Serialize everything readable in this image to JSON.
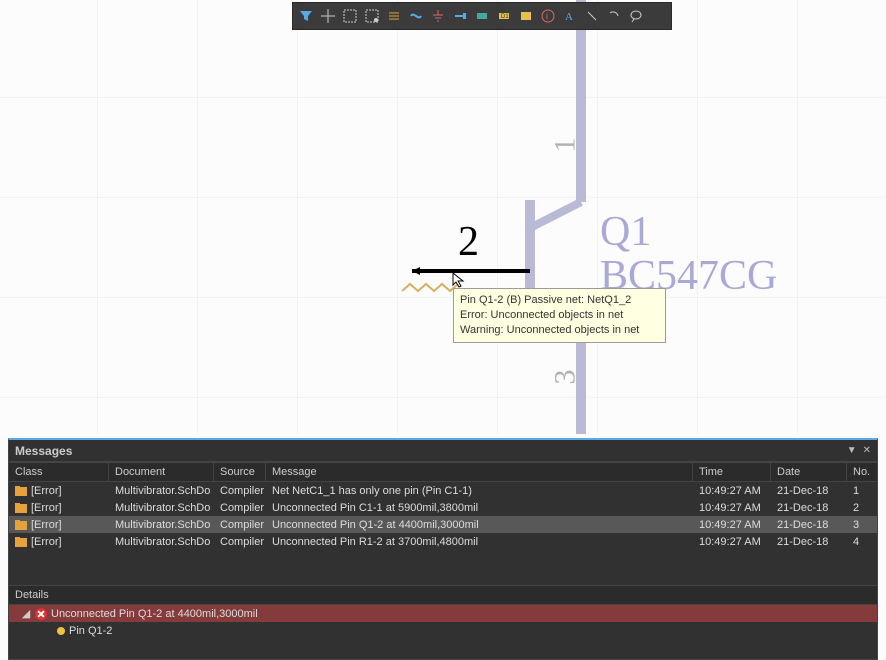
{
  "toolbar_icons": [
    "filter-icon",
    "crosshair-icon",
    "select-rect-icon",
    "select-lasso-icon",
    "connector-icon",
    "bus-icon",
    "ground-icon",
    "terminal-icon",
    "part-icon",
    "diode-icon",
    "text-label-icon",
    "info-icon",
    "annotate-icon",
    "undo-icon",
    "redo-icon",
    "lasso-icon"
  ],
  "schematic": {
    "pins": {
      "p1": "1",
      "p2": "2",
      "p3": "3"
    },
    "ref": "Q1",
    "part": "BC547CG"
  },
  "tooltip": {
    "line1": "Pin Q1-2 (B) Passive    net: NetQ1_2",
    "line2": "Error: Unconnected objects in net",
    "line3": "Warning: Unconnected objects in net"
  },
  "messages_panel": {
    "title": "Messages",
    "columns": {
      "class": "Class",
      "document": "Document",
      "source": "Source",
      "message": "Message",
      "time": "Time",
      "date": "Date",
      "no": "No."
    },
    "rows": [
      {
        "class": "[Error]",
        "document": "Multivibrator.SchDo",
        "source": "Compiler",
        "message": "Net NetC1_1 has only one pin (Pin C1-1)",
        "time": "10:49:27 AM",
        "date": "21-Dec-18",
        "no": "1",
        "selected": false
      },
      {
        "class": "[Error]",
        "document": "Multivibrator.SchDo",
        "source": "Compiler",
        "message": "Unconnected Pin C1-1 at 5900mil,3800mil",
        "time": "10:49:27 AM",
        "date": "21-Dec-18",
        "no": "2",
        "selected": false
      },
      {
        "class": "[Error]",
        "document": "Multivibrator.SchDo",
        "source": "Compiler",
        "message": "Unconnected Pin Q1-2 at 4400mil,3000mil",
        "time": "10:49:27 AM",
        "date": "21-Dec-18",
        "no": "3",
        "selected": true
      },
      {
        "class": "[Error]",
        "document": "Multivibrator.SchDo",
        "source": "Compiler",
        "message": "Unconnected Pin R1-2 at 3700mil,4800mil",
        "time": "10:49:27 AM",
        "date": "21-Dec-18",
        "no": "4",
        "selected": false
      }
    ],
    "details_label": "Details",
    "details": {
      "root": "Unconnected Pin Q1-2 at 4400mil,3000mil",
      "child": "Pin Q1-2"
    }
  }
}
